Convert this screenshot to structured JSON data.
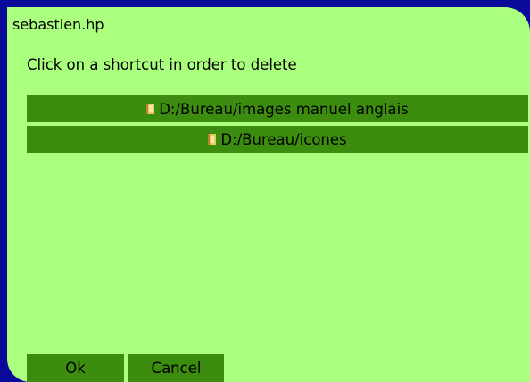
{
  "window": {
    "title": "sebastien.hp"
  },
  "dialog": {
    "instruction": "Click on a shortcut in order to delete",
    "shortcuts": [
      {
        "icon": "folder-icon",
        "label": "D:/Bureau/images manuel anglais"
      },
      {
        "icon": "folder-icon",
        "label": "D:/Bureau/icones"
      }
    ],
    "buttons": {
      "ok_label": "Ok",
      "cancel_label": "Cancel"
    }
  },
  "colors": {
    "background": "#0a0a9a",
    "dialog": "#aaff7f",
    "button": "#3c8c10"
  }
}
